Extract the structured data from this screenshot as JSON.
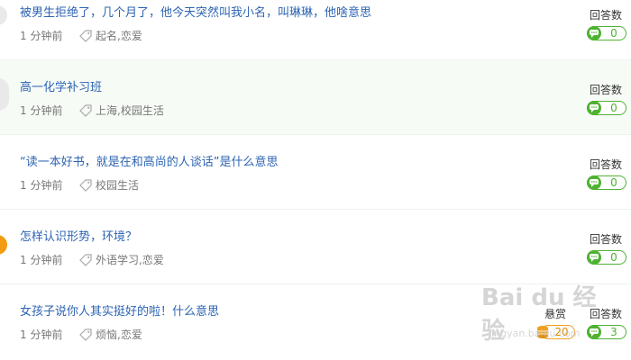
{
  "labels": {
    "answers": "回答数",
    "bounty": "悬赏"
  },
  "colors": {
    "title_link": "#2d64b3",
    "answer_green": "#4fb233",
    "bounty_orange": "#f0a020",
    "highlight_row": "#f7fbf6"
  },
  "questions": [
    {
      "title": "被男生拒绝了，几个月了，他今天突然叫我小名，叫琳琳，他啥意思",
      "time": "1 分钟前",
      "tags": "起名,恋爱",
      "answers": "0"
    },
    {
      "title": "高一化学补习班",
      "time": "1 分钟前",
      "tags": "上海,校园生活",
      "answers": "0"
    },
    {
      "title": "“读一本好书，就是在和高尚的人谈话”是什么意思",
      "time": "1 分钟前",
      "tags": "校园生活",
      "answers": "0"
    },
    {
      "title": "怎样认识形势，环境？",
      "time": "1 分钟前",
      "tags": "外语学习,恋爱",
      "answers": "0"
    },
    {
      "title": "女孩子说你人其实挺好的啦！什么意思",
      "time": "1 分钟前",
      "tags": "烦恼,恋爱",
      "answers": "3",
      "bounty": "20"
    }
  ],
  "watermark": {
    "logo": "Bai du 经验",
    "url": "jingyan.baidu.com"
  }
}
